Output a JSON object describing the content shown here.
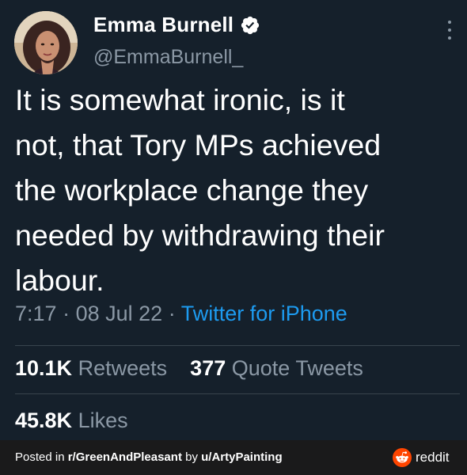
{
  "author": {
    "display_name": "Emma Burnell",
    "handle": "@EmmaBurnell_",
    "verified": true
  },
  "tweet": {
    "text": "It is somewhat ironic, is it\nnot, that Tory MPs achieved\nthe workplace change they\nneeded by withdrawing their\nlabour.",
    "time": "7:17",
    "separator": "·",
    "date": "08 Jul 22",
    "source": "Twitter for iPhone"
  },
  "stats": {
    "retweets_count": "10.1K",
    "retweets_label": "Retweets",
    "quote_count": "377",
    "quote_label": "Quote Tweets",
    "likes_count": "45.8K",
    "likes_label": "Likes"
  },
  "footer": {
    "posted_in": "Posted in ",
    "subreddit": "r/GreenAndPleasant",
    "by": " by ",
    "user": "u/ArtyPainting",
    "brand": "reddit"
  },
  "icons": {
    "verified": "verified-badge-icon",
    "more": "more-vertical-icon",
    "reddit": "reddit-alien-icon"
  },
  "colors": {
    "background": "#15202b",
    "text_primary": "#ffffff",
    "text_secondary": "#8b98a5",
    "link": "#1d9bf0",
    "divider": "#38444d",
    "footer_bg": "#1a1a1b",
    "reddit_orange": "#ff4500"
  }
}
